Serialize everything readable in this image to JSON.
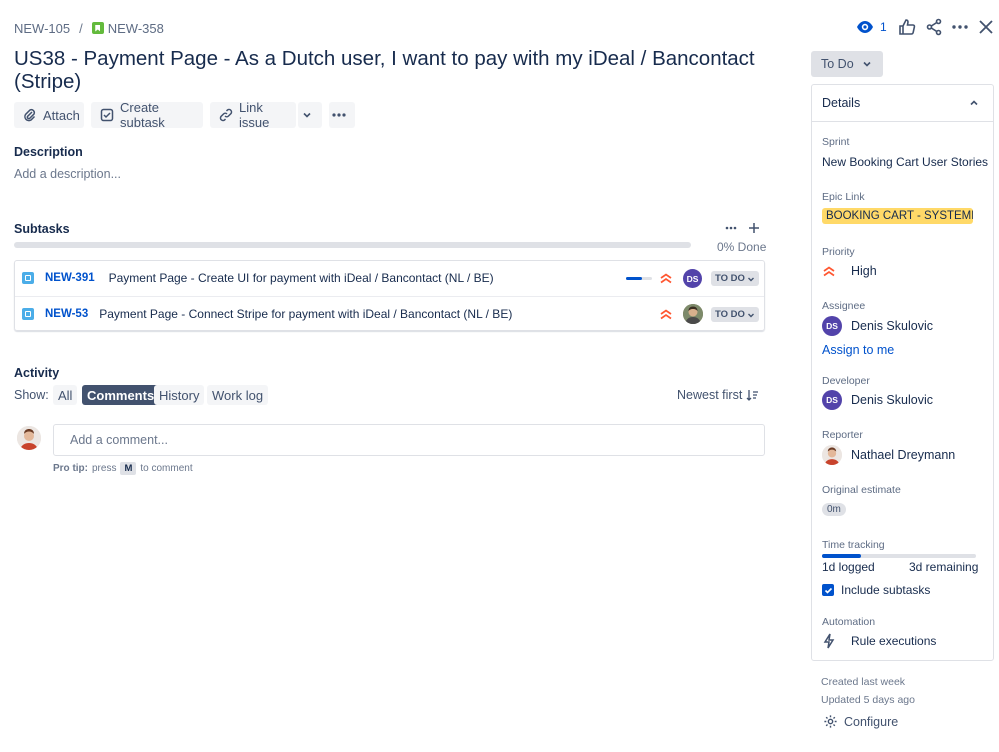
{
  "breadcrumb": {
    "parent": "NEW-105",
    "separator": "/",
    "current": "NEW-358"
  },
  "header": {
    "watchers": "1"
  },
  "title": "US38 - Payment Page - As a Dutch user, I want to pay with my iDeal / Bancontact (Stripe)",
  "toolbar": {
    "attach": "Attach",
    "create_subtask": "Create subtask",
    "link_issue": "Link issue"
  },
  "description": {
    "label": "Description",
    "placeholder": "Add a description..."
  },
  "subtasks": {
    "label": "Subtasks",
    "done_text": "0% Done",
    "done_fraction": 0,
    "items": [
      {
        "key": "NEW-391",
        "summary": "Payment Page - Create UI for payment with iDeal / Bancontact (NL / BE)",
        "status": "TO DO",
        "assignee_initials": "DS",
        "progress": 0.6
      },
      {
        "key": "NEW-53",
        "summary": "Payment Page - Connect Stripe for payment with iDeal / Bancontact (NL / BE)",
        "status": "TO DO"
      }
    ]
  },
  "activity": {
    "label": "Activity",
    "show_label": "Show:",
    "tabs": [
      "All",
      "Comments",
      "History",
      "Work log"
    ],
    "active_tab": "Comments",
    "sort": "Newest first",
    "comment_placeholder": "Add a comment...",
    "protip_label": "Pro tip:",
    "protip_press": "press",
    "protip_key": "M",
    "protip_rest": "to comment"
  },
  "status_button": "To Do",
  "details": {
    "heading": "Details",
    "sprint_label": "Sprint",
    "sprint": "New Booking Cart User Stories",
    "epic_label": "Epic Link",
    "epic": "BOOKING CART - SYSTEMP...",
    "priority_label": "Priority",
    "priority": "High",
    "assignee_label": "Assignee",
    "assignee": "Denis Skulovic",
    "assignee_initials": "DS",
    "assign_to_me": "Assign to me",
    "developer_label": "Developer",
    "developer": "Denis Skulovic",
    "developer_initials": "DS",
    "reporter_label": "Reporter",
    "reporter": "Nathael Dreymann",
    "estimate_label": "Original estimate",
    "estimate": "0m",
    "tracking_label": "Time tracking",
    "logged": "1d logged",
    "remaining": "3d remaining",
    "tracking_fraction": 0.25,
    "include_subtasks": "Include subtasks",
    "automation_label": "Automation",
    "rule_executions": "Rule executions"
  },
  "footer": {
    "created": "Created last week",
    "updated": "Updated 5 days ago",
    "configure": "Configure"
  },
  "colors": {
    "link": "#0052cc",
    "priority_high": "#ff5630",
    "epic": "#ffd968",
    "avatar": "#5243aa"
  }
}
